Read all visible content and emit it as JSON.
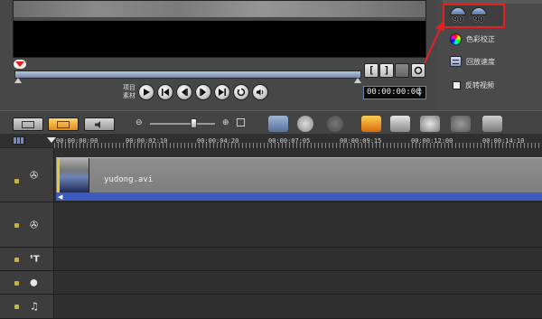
{
  "preview": {
    "timecode": "00:00:00:00",
    "project_label": "项目",
    "clip_label": "素材",
    "mark_in": "[",
    "mark_out": "]"
  },
  "options": {
    "rotate_left_label": "90",
    "rotate_right_label": "90",
    "color_correction": "色彩校正",
    "playback_speed": "回放速度",
    "reverse_video": "反转视频"
  },
  "timeline": {
    "ticks": [
      "00:00:00:00",
      "00:00:02:10",
      "00:00:04:20",
      "00:00:07:05",
      "00:00:09:15",
      "00:00:12:00",
      "00:00:14:10"
    ],
    "clip_name": "yudong.avi"
  },
  "colors": {
    "highlight": "#e62020",
    "scrub": "#6f86ad",
    "clip_band": "#3b5bbf"
  },
  "icons": [
    "play-icon",
    "home-icon",
    "prev-frame-icon",
    "next-frame-icon",
    "end-icon",
    "repeat-icon",
    "volume-icon"
  ]
}
